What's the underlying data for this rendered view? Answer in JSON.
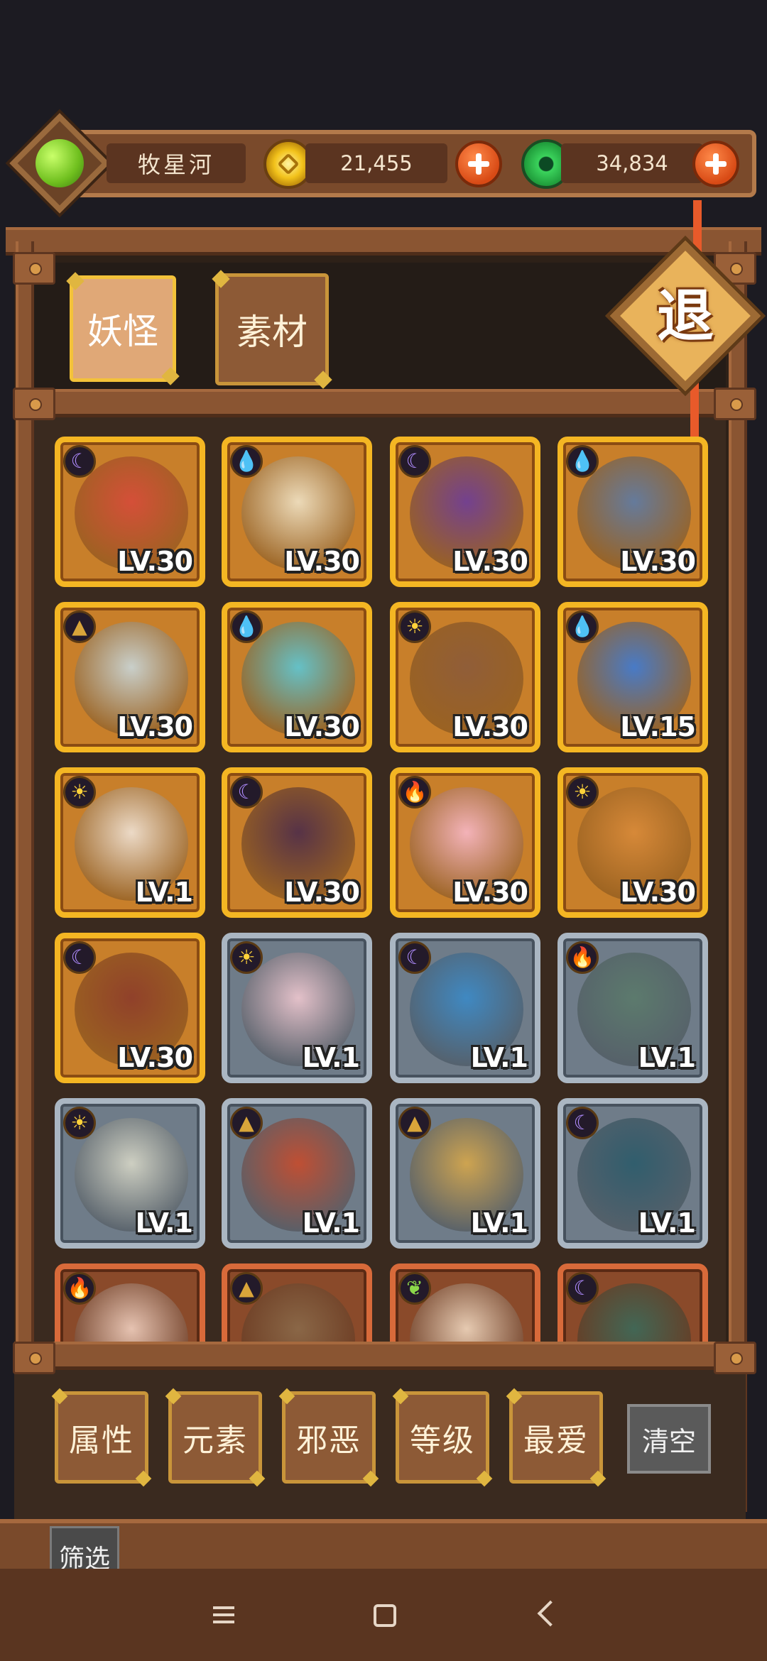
{
  "player": {
    "name": "牧星河"
  },
  "resources": {
    "gold": "21,455",
    "jade": "34,834"
  },
  "tabs": [
    {
      "label": "妖怪",
      "active": true
    },
    {
      "label": "素材",
      "active": false
    }
  ],
  "back_label": "退",
  "cards": [
    {
      "level": "LV.30",
      "frame": "gold",
      "element": "moon",
      "color": "#d64a3a"
    },
    {
      "level": "LV.30",
      "frame": "gold",
      "element": "water",
      "color": "#f0e4c8"
    },
    {
      "level": "LV.30",
      "frame": "gold",
      "element": "moon",
      "color": "#6a3a9a"
    },
    {
      "level": "LV.30",
      "frame": "gold",
      "element": "water",
      "color": "#5a7aa8"
    },
    {
      "level": "LV.30",
      "frame": "gold",
      "element": "earth",
      "color": "#c9d8dc"
    },
    {
      "level": "LV.30",
      "frame": "gold",
      "element": "water",
      "color": "#5ac8d8"
    },
    {
      "level": "LV.30",
      "frame": "gold",
      "element": "sun",
      "color": "#8a5a3a"
    },
    {
      "level": "LV.15",
      "frame": "gold",
      "element": "water",
      "color": "#3a7ad8"
    },
    {
      "level": "LV.1",
      "frame": "gold",
      "element": "sun",
      "color": "#f0e4d8"
    },
    {
      "level": "LV.30",
      "frame": "gold",
      "element": "moon",
      "color": "#4a2a4a"
    },
    {
      "level": "LV.30",
      "frame": "gold",
      "element": "fire",
      "color": "#f8b8c8"
    },
    {
      "level": "LV.30",
      "frame": "gold",
      "element": "sun",
      "color": "#d88a3a"
    },
    {
      "level": "LV.30",
      "frame": "gold",
      "element": "moon",
      "color": "#8a3a2a"
    },
    {
      "level": "LV.1",
      "frame": "silver",
      "element": "sun",
      "color": "#f0c8d0"
    },
    {
      "level": "LV.1",
      "frame": "silver",
      "element": "moon",
      "color": "#3a8ac8"
    },
    {
      "level": "LV.1",
      "frame": "silver",
      "element": "fire",
      "color": "#5a7a6a"
    },
    {
      "level": "LV.1",
      "frame": "silver",
      "element": "sun",
      "color": "#d8d8c8"
    },
    {
      "level": "LV.1",
      "frame": "silver",
      "element": "earth",
      "color": "#c84a2a"
    },
    {
      "level": "LV.1",
      "frame": "silver",
      "element": "earth",
      "color": "#d8a84a"
    },
    {
      "level": "LV.1",
      "frame": "silver",
      "element": "moon",
      "color": "#2a5a6a"
    },
    {
      "level": "",
      "frame": "bronze",
      "element": "fire",
      "color": "#f0d0c0"
    },
    {
      "level": "",
      "frame": "bronze",
      "element": "earth",
      "color": "#8a6a4a"
    },
    {
      "level": "",
      "frame": "bronze",
      "element": "leaf",
      "color": "#f0d8c0"
    },
    {
      "level": "",
      "frame": "bronze",
      "element": "moon",
      "color": "#3a6a5a"
    }
  ],
  "filters": [
    {
      "label": "属性"
    },
    {
      "label": "元素"
    },
    {
      "label": "邪恶"
    },
    {
      "label": "等级"
    },
    {
      "label": "最爱"
    }
  ],
  "clear_label": "清空",
  "filter_label": "筛选"
}
